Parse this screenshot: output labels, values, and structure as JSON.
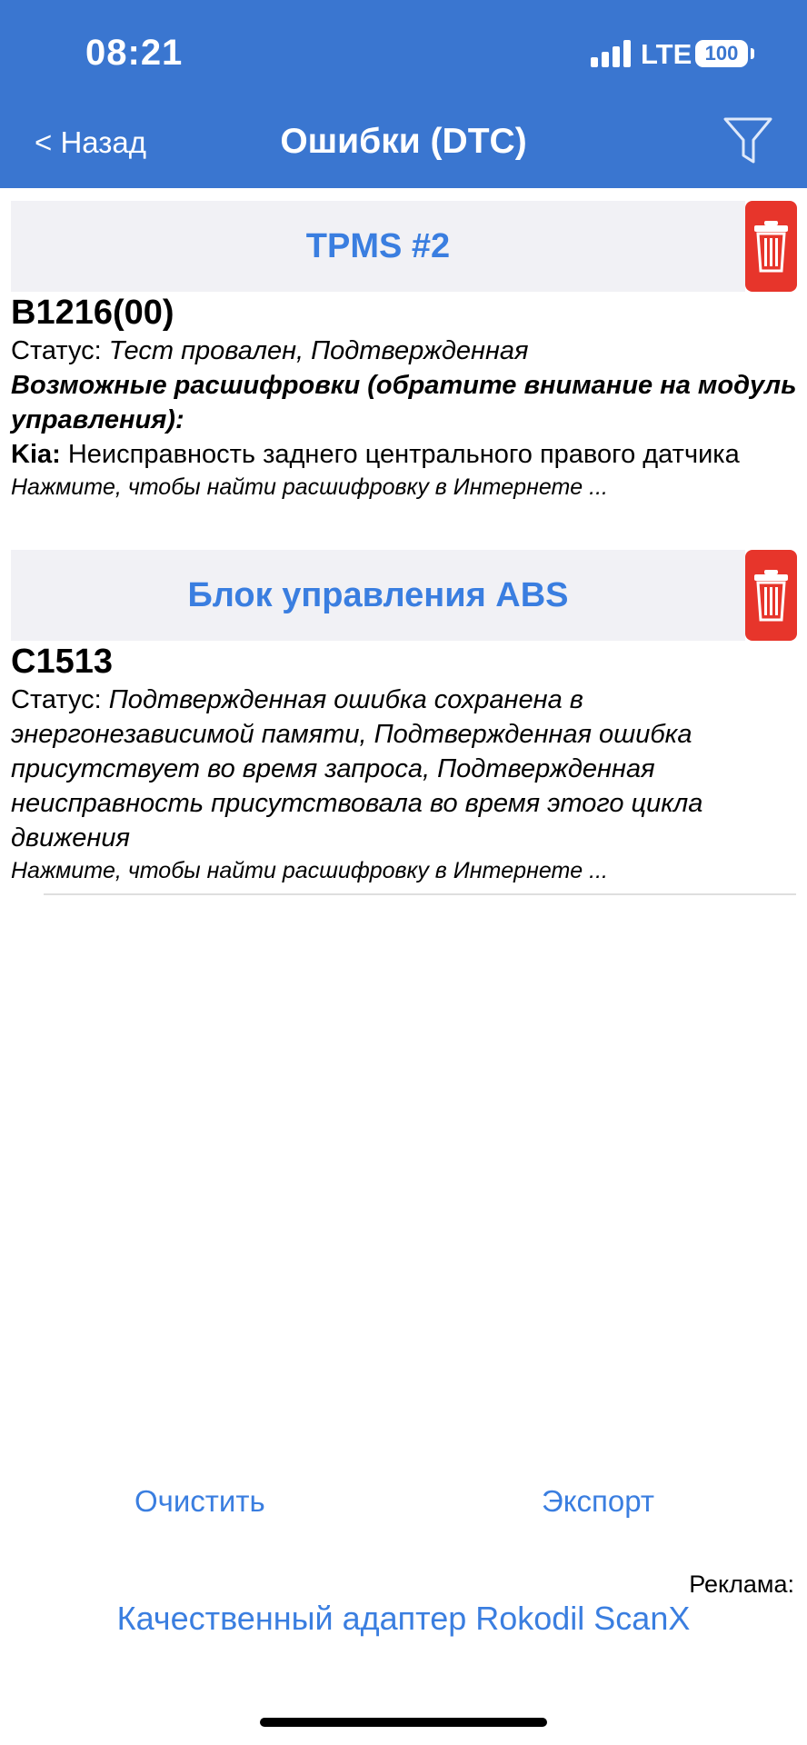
{
  "status_bar": {
    "time": "08:21",
    "network": "LTE",
    "battery": "100"
  },
  "nav": {
    "back_label": "< Назад",
    "title": "Ошибки (DTC)"
  },
  "modules": [
    {
      "name": "TPMS #2",
      "code": "B1216(00)",
      "status_label": "Статус: ",
      "status_value": "Тест провален, Подтвержденная",
      "decode_heading": "Возможные расшифровки (обратите внимание на модуль управления):",
      "decode_brand": "Kia:",
      "decode_text": " Неисправность заднего центрального правого датчика",
      "hint": "Нажмите, чтобы найти расшифровку в Интернете ..."
    },
    {
      "name": "Блок управления ABS",
      "code": "C1513",
      "status_label": "Статус: ",
      "status_value": "Подтвержденная ошибка сохранена в энергонезависимой памяти, Подтвержденная ошибка присутствует во время запроса, Подтвержденная неисправность присутствовала во время этого цикла движения",
      "hint": "Нажмите, чтобы найти расшифровку в Интернете ..."
    }
  ],
  "actions": {
    "clear_label": "Очистить",
    "export_label": "Экспорт"
  },
  "ad": {
    "label": "Реклама:",
    "link": "Качественный адаптер Rokodil ScanX"
  },
  "colors": {
    "header": "#3a76d0",
    "accent": "#3a7ee0",
    "delete": "#e7352b",
    "section_bg": "#f1f1f5"
  }
}
